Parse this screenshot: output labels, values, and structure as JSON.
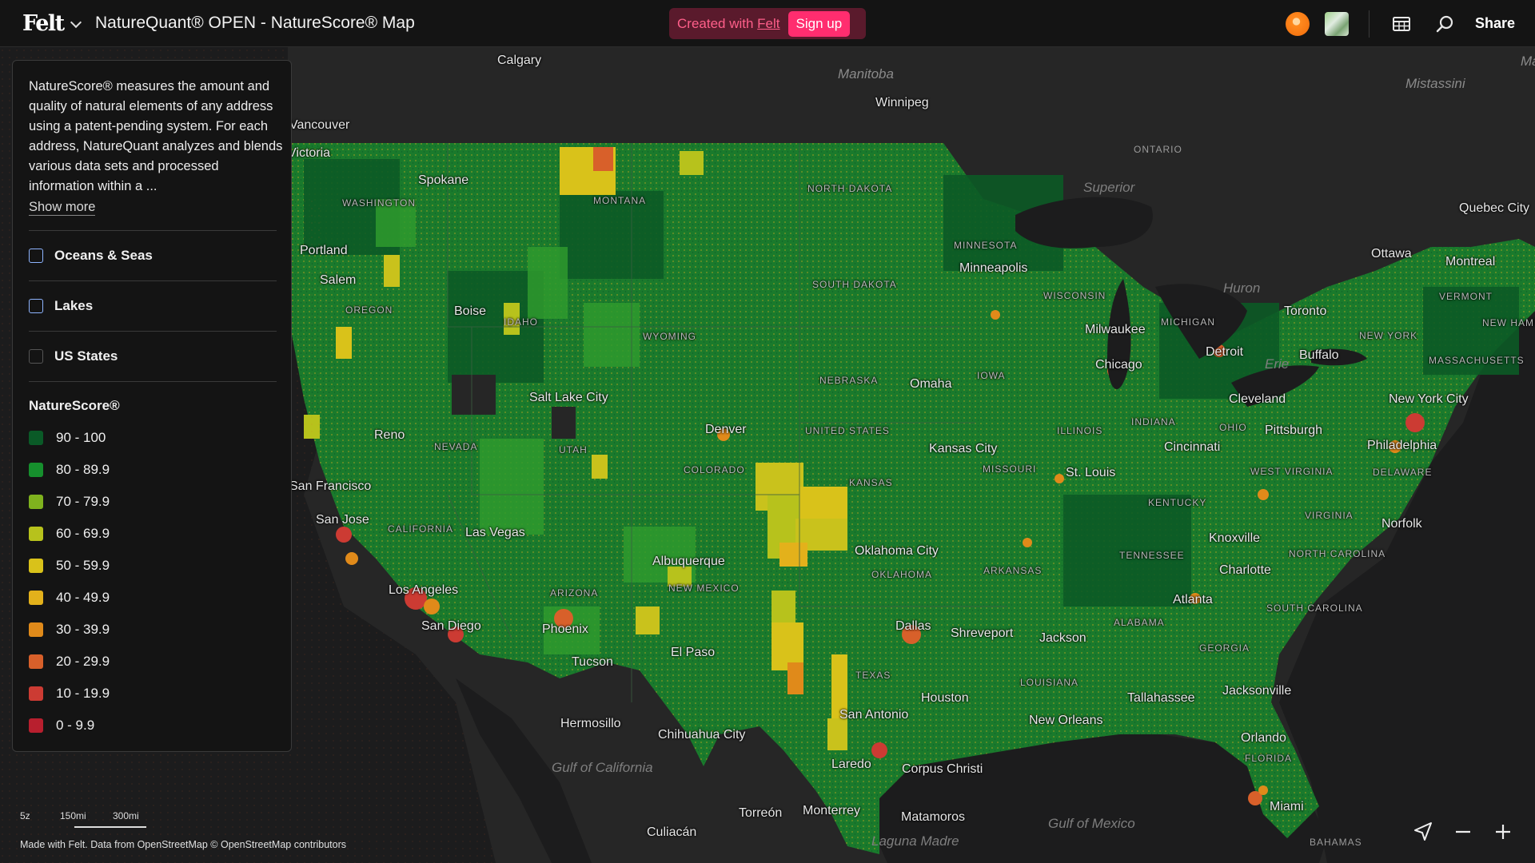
{
  "app": {
    "logo_text": "Felt",
    "title": "NatureQuant® OPEN - NatureScore® Map",
    "created_with": "Created with",
    "created_with_link": "Felt",
    "signup_label": "Sign up",
    "share_label": "Share"
  },
  "panel": {
    "description": "NatureScore® measures the amount and quality of natural elements of any address using a patent-pending system. For each address, NatureQuant analyzes and blends various data sets and processed information within a ...",
    "show_more": "Show more",
    "layers": [
      {
        "label": "Oceans & Seas",
        "checked": false
      },
      {
        "label": "Lakes",
        "checked": false
      },
      {
        "label": "US States",
        "checked": false
      }
    ],
    "legend_title": "NatureScore®",
    "legend": [
      {
        "label": "90 - 100",
        "color": "#0a5a27"
      },
      {
        "label": "80 - 89.9",
        "color": "#168f2d"
      },
      {
        "label": "70 - 79.9",
        "color": "#7fb21e"
      },
      {
        "label": "60 - 69.9",
        "color": "#b7c21c"
      },
      {
        "label": "50 - 59.9",
        "color": "#d9c21a"
      },
      {
        "label": "40 - 49.9",
        "color": "#e3b11b"
      },
      {
        "label": "30 - 39.9",
        "color": "#e08a1a"
      },
      {
        "label": "20 - 29.9",
        "color": "#d8602a"
      },
      {
        "label": "10 - 19.9",
        "color": "#cc3b33"
      },
      {
        "label": "0 - 9.9",
        "color": "#b81f2e"
      }
    ]
  },
  "map": {
    "cities": [
      "Calgary",
      "Winnipeg",
      "Vancouver",
      "Victoria",
      "Spokane",
      "Portland",
      "Salem",
      "Boise",
      "Minneapolis",
      "Milwaukee",
      "Chicago",
      "Detroit",
      "Toronto",
      "Buffalo",
      "Ottawa",
      "Montreal",
      "Quebec City",
      "Cleveland",
      "Pittsburgh",
      "New York City",
      "Philadelphia",
      "Omaha",
      "Salt Lake City",
      "Reno",
      "Denver",
      "Kansas City",
      "St. Louis",
      "Cincinnati",
      "San Francisco",
      "San Jose",
      "Las Vegas",
      "Norfolk",
      "Knoxville",
      "Charlotte",
      "Oklahoma City",
      "Albuquerque",
      "Los Angeles",
      "San Diego",
      "Phoenix",
      "Tucson",
      "El Paso",
      "Atlanta",
      "Dallas",
      "Shreveport",
      "Jackson",
      "Hermosillo",
      "Chihuahua City",
      "Houston",
      "New Orleans",
      "Tallahassee",
      "Jacksonville",
      "San Antonio",
      "Orlando",
      "Laredo",
      "Corpus Christi",
      "Torreón",
      "Monterrey",
      "Matamoros",
      "Culiacán",
      "Miami"
    ],
    "states": [
      "WASHINGTON",
      "MONTANA",
      "NORTH DAKOTA",
      "MINNESOTA",
      "OREGON",
      "IDAHO",
      "SOUTH DAKOTA",
      "WISCONSIN",
      "MICHIGAN",
      "WYOMING",
      "NEBRASKA",
      "IOWA",
      "NEVADA",
      "UTAH",
      "COLORADO",
      "UNITED STATES",
      "KANSAS",
      "MISSOURI",
      "ILLINOIS",
      "INDIANA",
      "OHIO",
      "WEST VIRGINIA",
      "KENTUCKY",
      "VIRGINIA",
      "CALIFORNIA",
      "ARIZONA",
      "NEW MEXICO",
      "OKLAHOMA",
      "ARKANSAS",
      "TENNESSEE",
      "NORTH CAROLINA",
      "SOUTH CAROLINA",
      "ALABAMA",
      "GEORGIA",
      "TEXAS",
      "LOUISIANA",
      "FLORIDA",
      "NEW YORK",
      "VERMONT",
      "NEW HAMPSHIRE",
      "MASSACHUSETTS",
      "DELAWARE",
      "ONTARIO"
    ],
    "regions": [
      "Manitoba",
      "Mistassini",
      "Superior",
      "Huron",
      "Erie",
      "Gulf of California",
      "Gulf of Mexico",
      "Laguna Madre",
      "BAHAMAS",
      "Ma"
    ]
  },
  "footer": {
    "zoom": "5z",
    "scale_1": "150mi",
    "scale_2": "300mi",
    "attribution": "Made with Felt. Data from OpenStreetMap © OpenStreetMap contributors"
  }
}
